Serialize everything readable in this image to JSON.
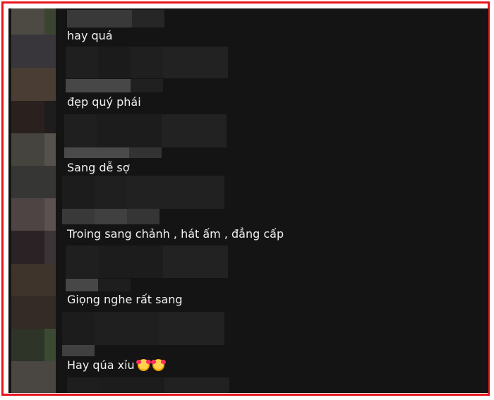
{
  "comments": [
    {
      "text": "hay quá"
    },
    {
      "text": "đẹp quý phái"
    },
    {
      "text": "Sang dễ sợ"
    },
    {
      "text": "Troing sang chảnh , hát ấm , đẳng cấp"
    },
    {
      "text": "Giọng nghe rất sang"
    },
    {
      "text": "Hay qúa xỉu",
      "emoji": "smiling-face-with-hearts-icon"
    }
  ],
  "colors": {
    "border": "#e8141c",
    "panel": "#141414",
    "text": "#f1f1f1"
  }
}
